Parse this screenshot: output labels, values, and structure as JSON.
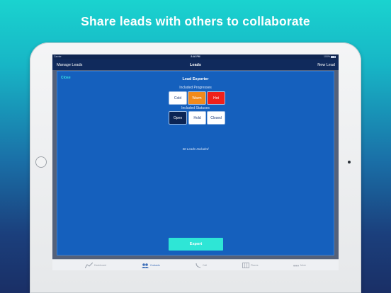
{
  "headline": "Share leads with others to collaborate",
  "status_bar": {
    "carrier": "Carrier",
    "time": "8:46 PM",
    "battery": "100%"
  },
  "nav": {
    "left": "Manage Leads",
    "title": "Leads",
    "right": "New Lead"
  },
  "modal": {
    "close": "Close",
    "title": "Lead Exporter",
    "progresses_label": "Included Progresses",
    "progresses": [
      {
        "label": "Cold",
        "bg": "#ffffff",
        "fg": "#1a3a7a"
      },
      {
        "label": "Warm",
        "bg": "#f18a1b",
        "fg": "#ffffff"
      },
      {
        "label": "Hot",
        "bg": "#f0201a",
        "fg": "#ffffff"
      }
    ],
    "statuses_label": "Included Statuses",
    "statuses": [
      {
        "label": "Open",
        "bg": "#0b2454",
        "fg": "#ffffff"
      },
      {
        "label": "Hold",
        "bg": "#ffffff",
        "fg": "#1a3a7a"
      },
      {
        "label": "Closed",
        "bg": "#ffffff",
        "fg": "#1a3a7a"
      }
    ],
    "leads_count": "50 Leads Included",
    "export": "Export"
  },
  "tabs": [
    {
      "label": "Dashboard",
      "icon": "chart-line-icon"
    },
    {
      "label": "Contacts",
      "icon": "contacts-icon"
    },
    {
      "label": "Call",
      "icon": "phone-icon"
    },
    {
      "label": "Places",
      "icon": "map-icon"
    },
    {
      "label": "More",
      "icon": "more-icon"
    }
  ],
  "colors": {
    "accent": "#2ee6d6",
    "modal_bg": "#1560bd",
    "nav_bg": "#102a5c"
  }
}
